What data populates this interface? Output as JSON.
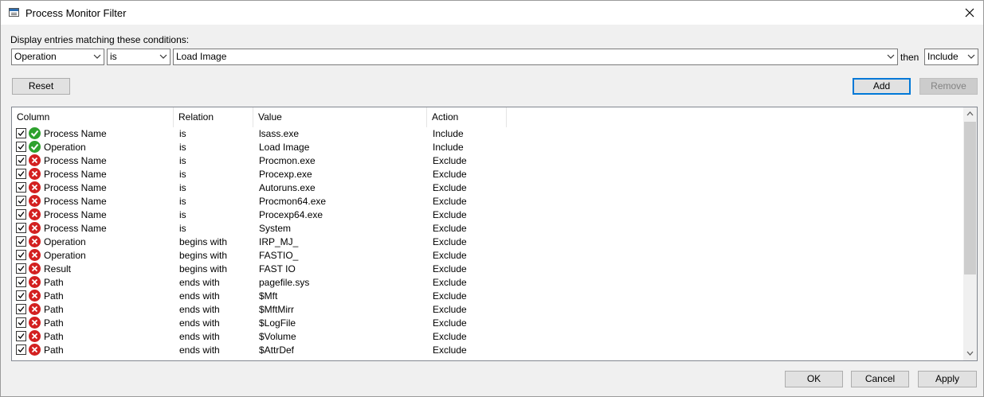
{
  "window": {
    "title": "Process Monitor Filter",
    "close_glyph": "✕"
  },
  "condition": {
    "label": "Display entries matching these conditions:",
    "column_value": "Operation",
    "relation_value": "is",
    "value_value": "Load Image",
    "then_label": "then",
    "action_value": "Include"
  },
  "buttons": {
    "reset": "Reset",
    "add": "Add",
    "remove": "Remove",
    "ok": "OK",
    "cancel": "Cancel",
    "apply": "Apply"
  },
  "colors": {
    "include": "#2ea12e",
    "exclude": "#d32020",
    "accent": "#0078d7"
  },
  "table": {
    "headers": {
      "column": "Column",
      "relation": "Relation",
      "value": "Value",
      "action": "Action"
    },
    "rows": [
      {
        "checked": true,
        "status": "include",
        "column": "Process Name",
        "relation": "is",
        "value": "lsass.exe",
        "action": "Include"
      },
      {
        "checked": true,
        "status": "include",
        "column": "Operation",
        "relation": "is",
        "value": "Load Image",
        "action": "Include"
      },
      {
        "checked": true,
        "status": "exclude",
        "column": "Process Name",
        "relation": "is",
        "value": "Procmon.exe",
        "action": "Exclude"
      },
      {
        "checked": true,
        "status": "exclude",
        "column": "Process Name",
        "relation": "is",
        "value": "Procexp.exe",
        "action": "Exclude"
      },
      {
        "checked": true,
        "status": "exclude",
        "column": "Process Name",
        "relation": "is",
        "value": "Autoruns.exe",
        "action": "Exclude"
      },
      {
        "checked": true,
        "status": "exclude",
        "column": "Process Name",
        "relation": "is",
        "value": "Procmon64.exe",
        "action": "Exclude"
      },
      {
        "checked": true,
        "status": "exclude",
        "column": "Process Name",
        "relation": "is",
        "value": "Procexp64.exe",
        "action": "Exclude"
      },
      {
        "checked": true,
        "status": "exclude",
        "column": "Process Name",
        "relation": "is",
        "value": "System",
        "action": "Exclude"
      },
      {
        "checked": true,
        "status": "exclude",
        "column": "Operation",
        "relation": "begins with",
        "value": "IRP_MJ_",
        "action": "Exclude"
      },
      {
        "checked": true,
        "status": "exclude",
        "column": "Operation",
        "relation": "begins with",
        "value": "FASTIO_",
        "action": "Exclude"
      },
      {
        "checked": true,
        "status": "exclude",
        "column": "Result",
        "relation": "begins with",
        "value": "FAST IO",
        "action": "Exclude"
      },
      {
        "checked": true,
        "status": "exclude",
        "column": "Path",
        "relation": "ends with",
        "value": "pagefile.sys",
        "action": "Exclude"
      },
      {
        "checked": true,
        "status": "exclude",
        "column": "Path",
        "relation": "ends with",
        "value": "$Mft",
        "action": "Exclude"
      },
      {
        "checked": true,
        "status": "exclude",
        "column": "Path",
        "relation": "ends with",
        "value": "$MftMirr",
        "action": "Exclude"
      },
      {
        "checked": true,
        "status": "exclude",
        "column": "Path",
        "relation": "ends with",
        "value": "$LogFile",
        "action": "Exclude"
      },
      {
        "checked": true,
        "status": "exclude",
        "column": "Path",
        "relation": "ends with",
        "value": "$Volume",
        "action": "Exclude"
      },
      {
        "checked": true,
        "status": "exclude",
        "column": "Path",
        "relation": "ends with",
        "value": "$AttrDef",
        "action": "Exclude"
      }
    ]
  }
}
